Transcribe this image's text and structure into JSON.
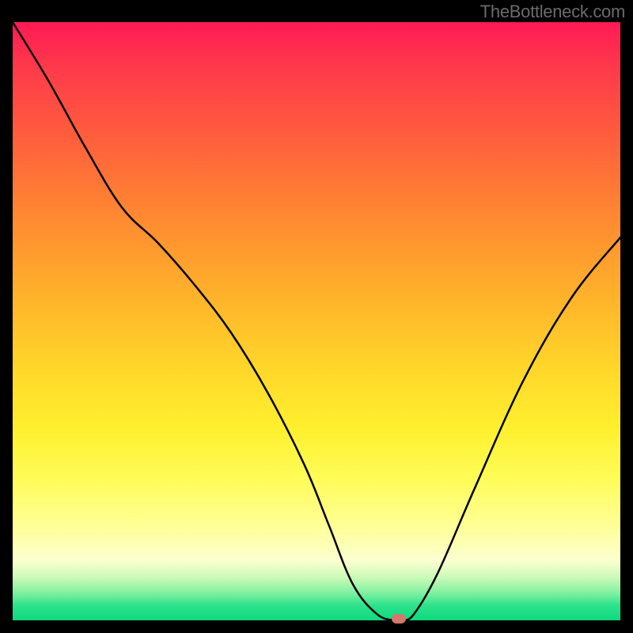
{
  "watermark": "TheBottleneck.com",
  "chart_data": {
    "type": "line",
    "title": "",
    "xlabel": "",
    "ylabel": "",
    "xlim": [
      0,
      100
    ],
    "ylim": [
      0,
      100
    ],
    "grid": false,
    "series": [
      {
        "name": "bottleneck-curve",
        "x": [
          0,
          6,
          12,
          18,
          24,
          30,
          36,
          42,
          48,
          52,
          56,
          60,
          63,
          64,
          66,
          70,
          76,
          84,
          92,
          100
        ],
        "y": [
          100,
          90,
          79,
          69,
          63,
          56,
          48,
          38,
          26,
          16,
          6,
          1,
          0,
          0,
          1,
          8,
          22,
          40,
          54,
          64
        ]
      }
    ],
    "marker": {
      "x": 63.5,
      "y": 0
    },
    "background_gradient": {
      "direction": "vertical",
      "stops": [
        {
          "pos": 0.0,
          "color": "#ff1a55"
        },
        {
          "pos": 0.48,
          "color": "#ffb92a"
        },
        {
          "pos": 0.84,
          "color": "#ffff94"
        },
        {
          "pos": 1.0,
          "color": "#0ed97f"
        }
      ]
    }
  }
}
